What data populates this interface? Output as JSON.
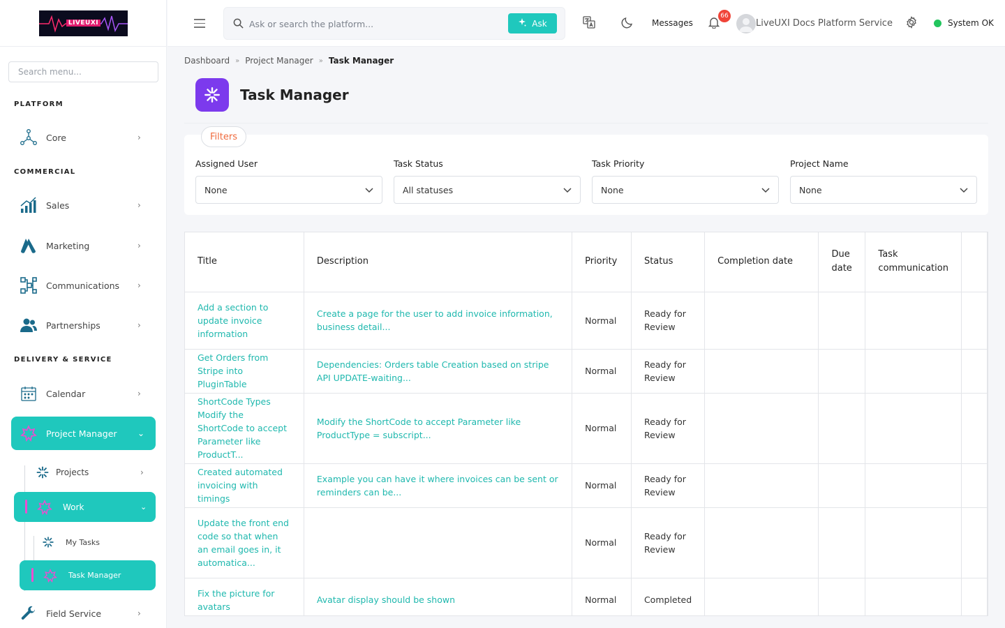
{
  "app": {
    "logo_text": "LIVEUXI"
  },
  "sidebar": {
    "search_placeholder": "Search menu...",
    "sections": {
      "platform": "PLATFORM",
      "commercial": "COMMERCIAL",
      "delivery": "DELIVERY & SERVICE"
    },
    "items": {
      "core": "Core",
      "sales": "Sales",
      "marketing": "Marketing",
      "communications": "Communications",
      "partnerships": "Partnerships",
      "calendar": "Calendar",
      "project_manager": "Project Manager",
      "projects": "Projects",
      "work": "Work",
      "my_tasks": "My Tasks",
      "task_manager": "Task Manager",
      "field_service": "Field Service"
    }
  },
  "topbar": {
    "search_placeholder": "Ask or search the platform...",
    "ask_label": "Ask",
    "messages_label": "Messages",
    "notification_count": "66",
    "user_name": "LiveUXI Docs Platform Service",
    "system_status": "System OK"
  },
  "breadcrumb": [
    "Dashboard",
    "Project Manager",
    "Task Manager"
  ],
  "page": {
    "title": "Task Manager"
  },
  "filters": {
    "title": "Filters",
    "assigned_user": {
      "label": "Assigned User",
      "value": "None"
    },
    "task_status": {
      "label": "Task Status",
      "value": "All statuses"
    },
    "task_priority": {
      "label": "Task Priority",
      "value": "None"
    },
    "project_name": {
      "label": "Project Name",
      "value": "None"
    }
  },
  "table": {
    "headers": [
      "Title",
      "Description",
      "Priority",
      "Status",
      "Completion date",
      "Due date",
      "Task communication"
    ],
    "rows": [
      {
        "title": "Add a section to update invoice information",
        "description": "Create a page for the user to add invoice information, business detail...",
        "priority": "Normal",
        "status": "Ready for Review",
        "completion": "",
        "due": "",
        "comm": ""
      },
      {
        "title": "Get Orders from Stripe into PluginTable",
        "description": "Dependencies: Orders table Creation based on stripe API UPDATE-waiting...",
        "priority": "Normal",
        "status": "Ready for Review",
        "completion": "",
        "due": "",
        "comm": ""
      },
      {
        "title": "ShortCode Types Modify the ShortCode to accept Parameter like ProductT...",
        "description": "Modify the ShortCode to accept Parameter like ProductType = subscript...",
        "priority": "Normal",
        "status": "Ready for Review",
        "completion": "",
        "due": "",
        "comm": ""
      },
      {
        "title": "Created automated invoicing with timings",
        "description": "Example you can have it where invoices can be sent or reminders can be...",
        "priority": "Normal",
        "status": "Ready for Review",
        "completion": "",
        "due": "",
        "comm": ""
      },
      {
        "title": "Update the front end code so that when an email goes in, it automatica...",
        "description": "",
        "priority": "Normal",
        "status": "Ready for Review",
        "completion": "",
        "due": "",
        "comm": ""
      },
      {
        "title": "Fix the picture for avatars",
        "description": "Avatar display should be shown",
        "priority": "Normal",
        "status": "Completed",
        "completion": "",
        "due": "",
        "comm": ""
      }
    ]
  },
  "colors": {
    "accent": "#1fc8bd",
    "purple": "#7c3aed",
    "filter_orange": "#f06a3c",
    "status_ok": "#22c55e",
    "badge_red": "#f04438"
  }
}
